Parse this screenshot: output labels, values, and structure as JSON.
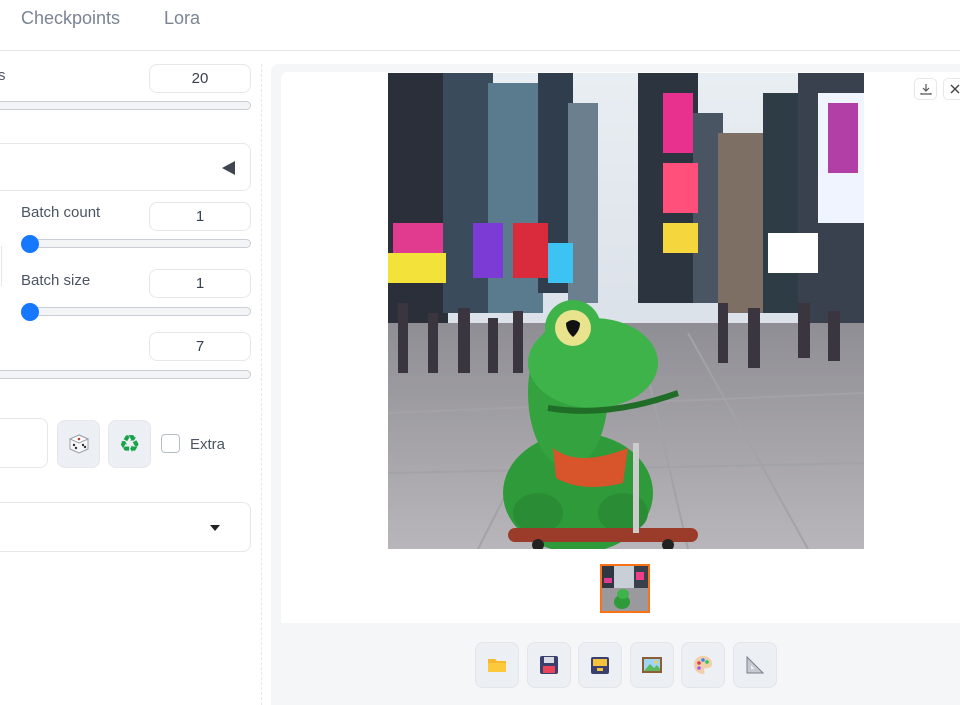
{
  "tabs": [
    {
      "label": "Checkpoints"
    },
    {
      "label": "Lora"
    }
  ],
  "params": {
    "steps": {
      "label_fragment": "s",
      "value": "20"
    },
    "batch_count": {
      "label": "Batch count",
      "value": "1"
    },
    "batch_size": {
      "label": "Batch size",
      "value": "1"
    },
    "cfg": {
      "value": "7"
    }
  },
  "seed": {
    "dice_icon": "dice-icon",
    "recycle_icon": "recycle-icon",
    "extra_label": "Extra",
    "extra_checked": false
  },
  "gallery": {
    "main_image": "generated-image-frog-on-skateboard-times-square",
    "thumbnail_selected": true,
    "download_icon": "download-icon",
    "close_icon": "close-icon",
    "actions": [
      {
        "name": "open-folder-button",
        "icon": "folder-icon"
      },
      {
        "name": "save-button",
        "icon": "floppy-disk-icon"
      },
      {
        "name": "zip-button",
        "icon": "archive-icon"
      },
      {
        "name": "send-to-img2img-button",
        "icon": "picture-icon"
      },
      {
        "name": "send-to-inpaint-button",
        "icon": "palette-icon"
      },
      {
        "name": "send-to-extras-button",
        "icon": "triangle-ruler-icon"
      }
    ]
  },
  "colors": {
    "accent_blue": "#1677ff",
    "selection_orange": "#f97316"
  }
}
